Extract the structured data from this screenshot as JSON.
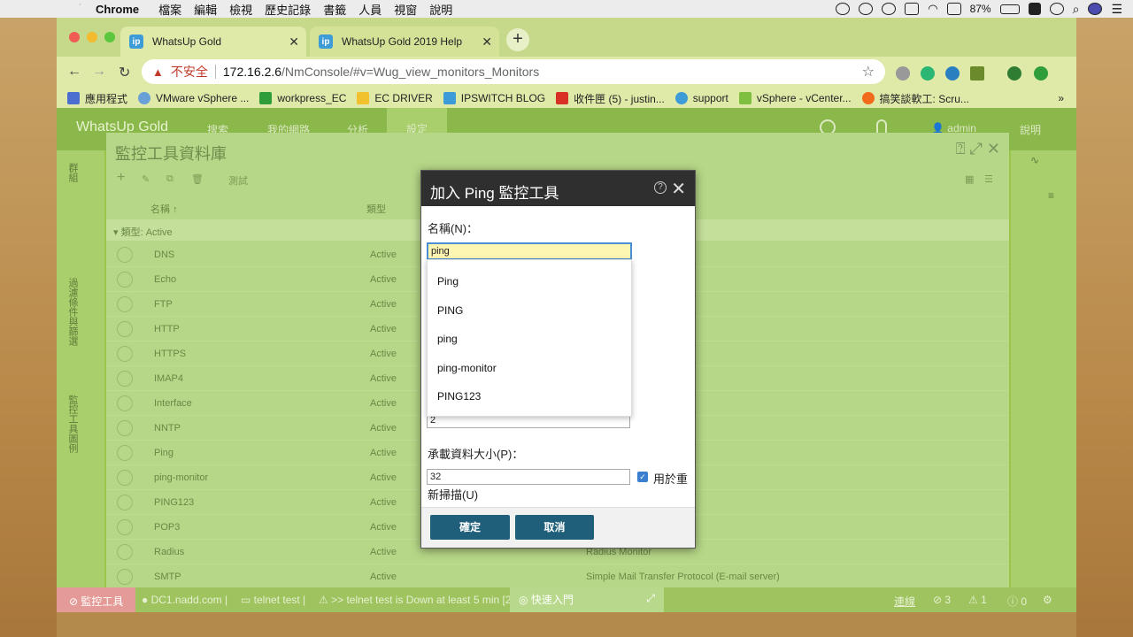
{
  "menubar": {
    "app": "Chrome",
    "items": [
      "檔案",
      "編輯",
      "檢視",
      "歷史記錄",
      "書籤",
      "人員",
      "視窗",
      "說明"
    ],
    "battery": "87%"
  },
  "tabs": [
    {
      "title": "WhatsUp Gold",
      "favicon": "ip"
    },
    {
      "title": "WhatsUp Gold 2019 Help",
      "favicon": "ip"
    }
  ],
  "address": {
    "insecure_label": "不安全",
    "host": "172.16.2.6",
    "path": "/NmConsole/#v=Wug_view_monitors_Monitors"
  },
  "bookmarks": [
    "應用程式",
    "VMware vSphere ...",
    "workpress_EC",
    "EC DRIVER",
    "IPSWITCH BLOG",
    "收件匣 (5) - justin...",
    "support",
    "vSphere - vCenter...",
    "搞笑談軟工: Scru..."
  ],
  "app": {
    "brand": "WhatsUp Gold",
    "nav": [
      "搜索",
      "我的網路",
      "分析",
      "設定"
    ],
    "user": "admin",
    "help": "說明"
  },
  "sidebar": {
    "groups": "群組",
    "filter": "過濾條件與篩選",
    "legend": "監控工具圖例"
  },
  "panel": {
    "title": "監控工具資料庫",
    "test_label": "測試",
    "col_name": "名稱",
    "col_type": "類型",
    "group_label": "類型: Active",
    "rows": [
      {
        "name": "DNS",
        "type": "Active",
        "desc": ""
      },
      {
        "name": "Echo",
        "type": "Active",
        "desc": ""
      },
      {
        "name": "FTP",
        "type": "Active",
        "desc": "P Server)"
      },
      {
        "name": "HTTP",
        "type": "Active",
        "desc": "ocol (Web Server)"
      },
      {
        "name": "HTTPS",
        "type": "Active",
        "desc": "er Protocol (Web Server)"
      },
      {
        "name": "IMAP4",
        "type": "Active",
        "desc": "Protocol V4"
      },
      {
        "name": "Interface",
        "type": "Active",
        "desc": ""
      },
      {
        "name": "NNTP",
        "type": "Active",
        "desc": "Protocol"
      },
      {
        "name": "Ping",
        "type": "Active",
        "desc": ""
      },
      {
        "name": "ping-monitor",
        "type": "Active",
        "desc": ""
      },
      {
        "name": "PING123",
        "type": "Active",
        "desc": ""
      },
      {
        "name": "POP3",
        "type": "Active",
        "desc": ""
      },
      {
        "name": "Radius",
        "type": "Active",
        "desc": "Radius Monitor"
      },
      {
        "name": "SMTP",
        "type": "Active",
        "desc": "Simple Mail Transfer Protocol (E-mail server)"
      }
    ]
  },
  "statusbar": {
    "monitor_tool": "監控工具",
    "device": "DC1.nadd.com",
    "telnet": "telnet test",
    "message": ">> telnet test is Down at least 5 min [2",
    "quickstart": "快速入門",
    "link": "連線",
    "err_count": "3",
    "warn_count": "1",
    "info_count": "0"
  },
  "dialog": {
    "title": "加入 Ping 監控工具",
    "name_label": "名稱(N)：",
    "name_value": "ping",
    "suggestions": [
      "Ping",
      "PING",
      "ping",
      "ping-monitor",
      "PING123"
    ],
    "hidden_field_value": "2",
    "payload_label": "承載資料大小(P)：",
    "payload_value": "32",
    "rescan_label_1": "用於重",
    "rescan_label_2": "新掃描(U)",
    "rescan_checked": true,
    "ok": "確定",
    "cancel": "取消"
  }
}
